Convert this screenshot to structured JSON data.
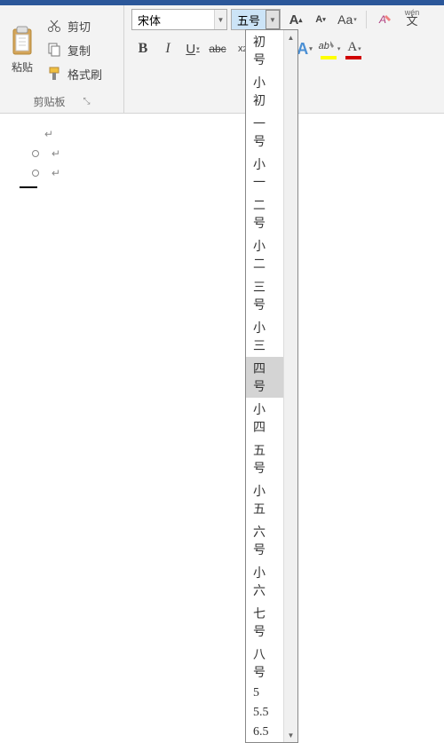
{
  "titlebar": {},
  "clipboard": {
    "paste": "粘贴",
    "cut": "剪切",
    "copy": "复制",
    "format_painter": "格式刷",
    "group_label": "剪贴板"
  },
  "font": {
    "fontname": "宋体",
    "fontsize_selected": "五号",
    "dropdown_items": [
      "初号",
      "小初",
      "一号",
      "小一",
      "二号",
      "小二",
      "三号",
      "小三",
      "四号",
      "小四",
      "五号",
      "小五",
      "六号",
      "小六",
      "七号",
      "八号",
      "5",
      "5.5",
      "6.5"
    ],
    "dropdown_hovered": "四号",
    "grow": "A",
    "shrink": "A",
    "change_case": "Aa",
    "bold": "B",
    "italic": "I",
    "underline": "U",
    "strike": "abc",
    "sub": "x",
    "text_effect": "A",
    "highlight": "ab",
    "fontcolor": "A",
    "wen": "文",
    "ruby": "wén"
  }
}
